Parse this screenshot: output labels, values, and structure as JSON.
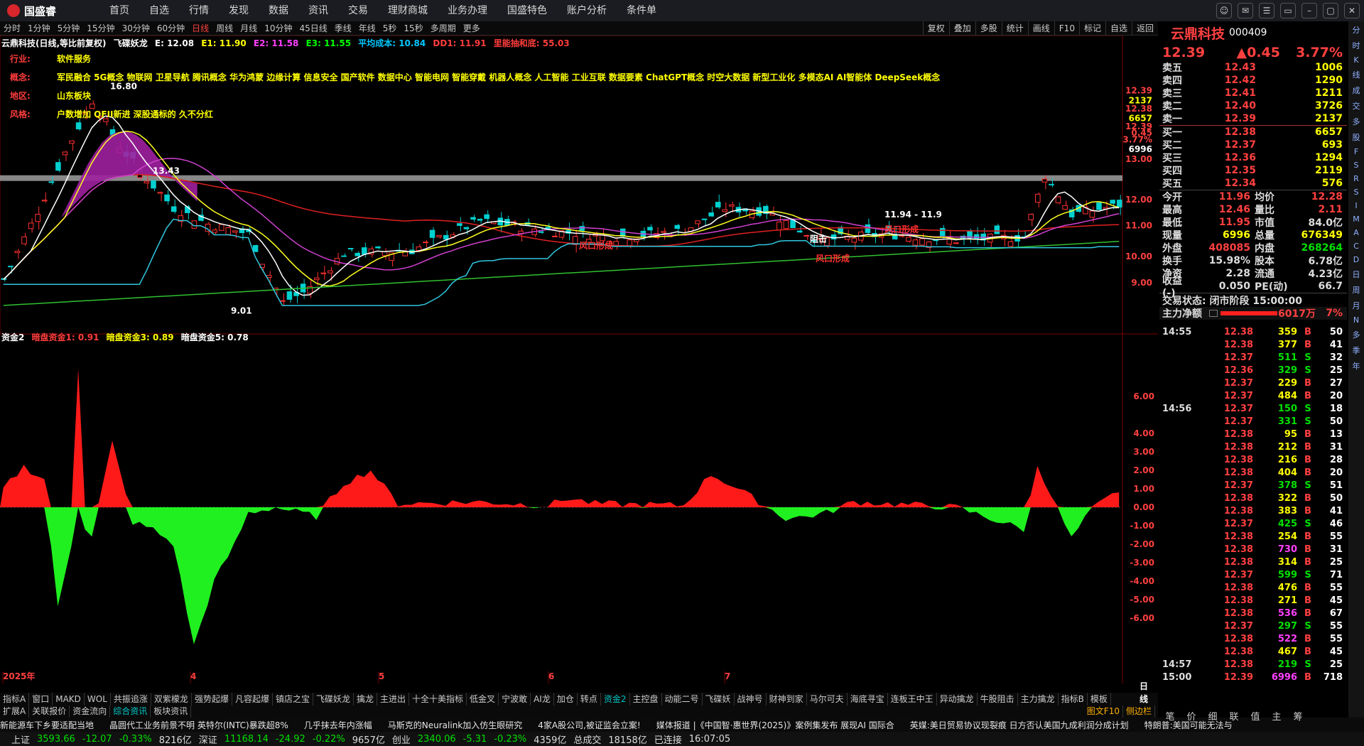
{
  "app": {
    "logo": "国盛睿"
  },
  "menu": [
    "首页",
    "自选",
    "行情",
    "发现",
    "数据",
    "资讯",
    "交易",
    "理财商城",
    "业务办理",
    "国盛特色",
    "账户分析",
    "条件单"
  ],
  "period_tabs": [
    "分时",
    "1分钟",
    "5分钟",
    "15分钟",
    "30分钟",
    "60分钟",
    "日线",
    "周线",
    "月线",
    "10分钟",
    "45日线",
    "季线",
    "年线",
    "5秒",
    "15秒",
    "多周期",
    "更多"
  ],
  "right_toolbar": [
    "复权",
    "叠加",
    "多股",
    "统计",
    "画线",
    "F10",
    "标记",
    "自选",
    "返回"
  ],
  "legend1": [
    {
      "t": "云鼎科技(日线,等比前复权)",
      "c": "#ffffff"
    },
    {
      "t": "飞碟妖龙",
      "c": "#ffffff"
    },
    {
      "t": "E: 12.08",
      "c": "#ffffff"
    },
    {
      "t": "E1: 11.90",
      "c": "#ffff00"
    },
    {
      "t": "E2: 11.58",
      "c": "#ff40ff"
    },
    {
      "t": "E3: 11.55",
      "c": "#00ff00"
    },
    {
      "t": "平均成本: 10.84",
      "c": "#00c8ff"
    },
    {
      "t": "DD1: 11.91",
      "c": "#ff3c3c"
    },
    {
      "t": "里能抽和底: 55.03",
      "c": "#ff3c3c"
    }
  ],
  "info": [
    {
      "k": "行业:",
      "v": "软件服务"
    },
    {
      "k": "概念:",
      "v": "军民融合 5G概念 物联网 卫星导航 腾讯概念 华为鸿蒙 边缘计算 信息安全 国产软件 数据中心 智能电网 智能穿戴 机器人概念 人工智能 工业互联 数据要素 ChatGPT概念 时空大数据 新型工业化 多模态AI AI智能体 DeepSeek概念"
    },
    {
      "k": "地区:",
      "v": "山东板块"
    },
    {
      "k": "风格:",
      "v": "户数增加 QFII新进 深股通标的 久不分红"
    }
  ],
  "legend2": [
    {
      "t": "资金2",
      "c": "#ffffff"
    },
    {
      "t": "暗盘资金1: 0.91",
      "c": "#ff3c3c"
    },
    {
      "t": "暗盘资金3: 0.89",
      "c": "#ffff00"
    },
    {
      "t": "暗盘资金5: 0.78",
      "c": "#ffffff"
    }
  ],
  "chart_data": [
    {
      "type": "candlestick",
      "title": "云鼎科技(日线,等比前复权)",
      "y_axis_ticks": [
        "12.39",
        "2137",
        "12.38",
        "6657",
        "12.39",
        "0.45",
        "3.77%",
        "6996",
        "13.00",
        "12.00",
        "11.00",
        "10.00",
        "9.00"
      ],
      "annotations": [
        "16.80",
        "13.43",
        "9.01",
        "11.94 - 11.9",
        "风口形成",
        "风口形成",
        "风口形成",
        "阻击"
      ],
      "month_labels": [
        "2025年",
        "4",
        "5",
        "6",
        "7"
      ],
      "ylim": [
        8.6,
        17.2
      ]
    },
    {
      "type": "area",
      "title": "资金2",
      "y_axis_ticks": [
        "6.00",
        "4.00",
        "3.00",
        "2.00",
        "1.00",
        "0.00",
        "-1.00",
        "-2.00",
        "-3.00",
        "-4.00",
        "-5.00",
        "-6.00"
      ],
      "ylim": [
        -9,
        9
      ],
      "series": [
        {
          "name": "暗盘资金1",
          "values": [
            0.91
          ]
        },
        {
          "name": "暗盘资金3",
          "values": [
            0.89
          ]
        },
        {
          "name": "暗盘资金5",
          "values": [
            0.78
          ]
        }
      ]
    }
  ],
  "bottom_x": "日线",
  "bottom_tabs": [
    "指标A",
    "窗口",
    "MAKD",
    "WOL",
    "共振追涨",
    "双紫檬龙",
    "强势起爆",
    "凡容起爆",
    "镇店之宝",
    "飞碟妖龙",
    "擒龙",
    "主进出",
    "十全十美指标",
    "低金叉",
    "宁波敢",
    "AI龙",
    "加仓",
    "转点",
    "资金2",
    "主控盘",
    "动能二号",
    "飞碟妖",
    "战神号",
    "财神到家",
    "马尔可夫",
    "海底寻宝",
    "连板王中王",
    "异动擒龙",
    "牛股阻击",
    "主力擒龙",
    "指标B",
    "模板"
  ],
  "second_tabs": [
    "扩展A",
    "关联报价",
    "资金流向",
    "综合资讯",
    "板块资讯"
  ],
  "right_tags": [
    "图文F10",
    "侧边栏"
  ],
  "news": [
    "新能源车下乡要适配当地",
    "晶圆代工业务前景不明 英特尔(INTC)暴跌超8%",
    "几乎抹去年内涨幅",
    "马斯克的Neuralink加入仿生眼研究",
    "4家A股公司,被证监会立案!",
    "媒体报道 |《中国智·惠世界(2025)》案例集发布 展现AI 国际合",
    "英媒:美日贸易协议现裂痕 日方否认美国九成利润分成计划",
    "特朗普:美国可能无法与"
  ],
  "status": [
    {
      "t": "上证",
      "c": "#dddddd"
    },
    {
      "t": "3593.66",
      "c": "#00e000"
    },
    {
      "t": "-12.07",
      "c": "#00e000"
    },
    {
      "t": "-0.33%",
      "c": "#00e000"
    },
    {
      "t": "8216亿",
      "c": "#dddddd"
    },
    {
      "t": "深证",
      "c": "#dddddd"
    },
    {
      "t": "11168.14",
      "c": "#00e000"
    },
    {
      "t": "-24.92",
      "c": "#00e000"
    },
    {
      "t": "-0.22%",
      "c": "#00e000"
    },
    {
      "t": "9657亿",
      "c": "#dddddd"
    },
    {
      "t": "创业",
      "c": "#dddddd"
    },
    {
      "t": "2340.06",
      "c": "#00e000"
    },
    {
      "t": "-5.31",
      "c": "#00e000"
    },
    {
      "t": "-0.23%",
      "c": "#00e000"
    },
    {
      "t": "4359亿",
      "c": "#dddddd"
    },
    {
      "t": "总成交",
      "c": "#dddddd"
    },
    {
      "t": "18158亿",
      "c": "#dddddd"
    },
    {
      "t": "已连接",
      "c": "#dddddd"
    },
    {
      "t": "16:07:05",
      "c": "#dddddd"
    }
  ],
  "stock": {
    "name": "云鼎科技",
    "code": "000409",
    "price": "12.39",
    "change": "▲0.45",
    "pct": "3.77%"
  },
  "asks": [
    {
      "l": "卖五",
      "p": "12.43",
      "v": "1006"
    },
    {
      "l": "卖四",
      "p": "12.42",
      "v": "1290"
    },
    {
      "l": "卖三",
      "p": "12.41",
      "v": "1211"
    },
    {
      "l": "卖二",
      "p": "12.40",
      "v": "3726"
    },
    {
      "l": "卖一",
      "p": "12.39",
      "v": "2137"
    }
  ],
  "bids": [
    {
      "l": "买一",
      "p": "12.38",
      "v": "6657"
    },
    {
      "l": "买二",
      "p": "12.37",
      "v": "693"
    },
    {
      "l": "买三",
      "p": "12.36",
      "v": "1294"
    },
    {
      "l": "买四",
      "p": "12.35",
      "v": "2119"
    },
    {
      "l": "买五",
      "p": "12.34",
      "v": "576"
    }
  ],
  "stats": [
    {
      "a": "今开",
      "b": "11.96",
      "bc": "#ff4040",
      "c": "均价",
      "d": "12.28",
      "dc": "#ff4040"
    },
    {
      "a": "最高",
      "b": "12.46",
      "bc": "#ff4040",
      "c": "量比",
      "d": "2.11",
      "dc": "#ff4040"
    },
    {
      "a": "最低",
      "b": "11.95",
      "bc": "#ff4040",
      "c": "市值",
      "d": "84.0亿",
      "dc": "#dddddd"
    },
    {
      "a": "现量",
      "b": "6996",
      "bc": "#ffff00",
      "c": "总量",
      "d": "676349",
      "dc": "#ffff00"
    },
    {
      "a": "外盘",
      "b": "408085",
      "bc": "#ff4040",
      "c": "内盘",
      "d": "268264",
      "dc": "#00e000"
    },
    {
      "a": "换手",
      "b": "15.98%",
      "bc": "#dddddd",
      "c": "股本",
      "d": "6.78亿",
      "dc": "#dddddd"
    },
    {
      "a": "净资",
      "b": "2.28",
      "bc": "#dddddd",
      "c": "流通",
      "d": "4.23亿",
      "dc": "#dddddd"
    },
    {
      "a": "收益(-)",
      "b": "0.050",
      "bc": "#dddddd",
      "c": "PE(动)",
      "d": "66.7",
      "dc": "#dddddd"
    }
  ],
  "trade_status": "交易状态: 闭市阶段 15:00:00",
  "main_flow": {
    "label": "主力净额",
    "value": "6017万",
    "pct": "7%"
  },
  "ticks": [
    [
      "14:55",
      "12.38",
      "359",
      "B",
      "50"
    ],
    [
      "",
      "12.38",
      "377",
      "B",
      "41"
    ],
    [
      "",
      "12.37",
      "511",
      "S",
      "32"
    ],
    [
      "",
      "12.36",
      "329",
      "S",
      "25"
    ],
    [
      "",
      "12.37",
      "229",
      "B",
      "27"
    ],
    [
      "",
      "12.37",
      "484",
      "B",
      "20"
    ],
    [
      "14:56",
      "12.37",
      "150",
      "S",
      "18"
    ],
    [
      "",
      "12.37",
      "331",
      "S",
      "50"
    ],
    [
      "",
      "12.38",
      "95",
      "B",
      "13"
    ],
    [
      "",
      "12.38",
      "212",
      "B",
      "31"
    ],
    [
      "",
      "12.38",
      "216",
      "B",
      "28"
    ],
    [
      "",
      "12.38",
      "404",
      "B",
      "20"
    ],
    [
      "",
      "12.37",
      "378",
      "S",
      "51"
    ],
    [
      "",
      "12.38",
      "322",
      "B",
      "50"
    ],
    [
      "",
      "12.38",
      "383",
      "B",
      "41"
    ],
    [
      "",
      "12.37",
      "425",
      "S",
      "46"
    ],
    [
      "",
      "12.38",
      "254",
      "B",
      "55"
    ],
    [
      "",
      "12.38",
      "730",
      "B",
      "31"
    ],
    [
      "",
      "12.38",
      "314",
      "B",
      "25"
    ],
    [
      "",
      "12.37",
      "599",
      "S",
      "71"
    ],
    [
      "",
      "12.38",
      "476",
      "B",
      "55"
    ],
    [
      "",
      "12.38",
      "271",
      "B",
      "45"
    ],
    [
      "",
      "12.38",
      "536",
      "B",
      "67"
    ],
    [
      "",
      "12.37",
      "297",
      "S",
      "55"
    ],
    [
      "",
      "12.38",
      "522",
      "B",
      "55"
    ],
    [
      "",
      "12.38",
      "467",
      "B",
      "45"
    ],
    [
      "14:57",
      "12.38",
      "219",
      "S",
      "25"
    ],
    [
      "15:00",
      "12.39",
      "6996",
      "B",
      "718"
    ]
  ],
  "right_bottom_tabs": [
    "笔",
    "价",
    "细",
    "联",
    "值",
    "主",
    "筹"
  ],
  "side_icons": [
    "分",
    "时",
    "K",
    "线",
    "成",
    "交",
    "多",
    "股",
    "F",
    "S",
    "R",
    "S",
    "I",
    "M",
    "A",
    "C",
    "D",
    "日",
    "周",
    "月",
    "N",
    "多",
    "季",
    "年"
  ]
}
